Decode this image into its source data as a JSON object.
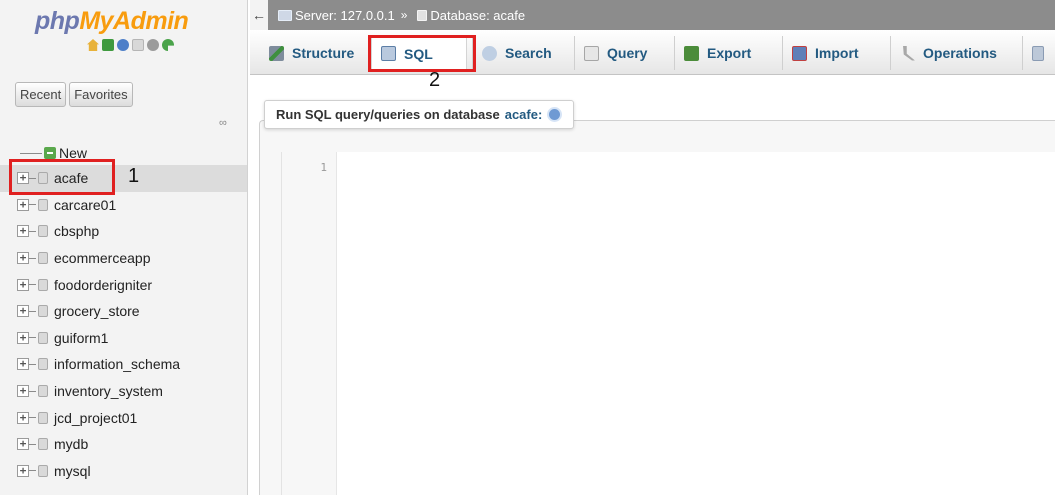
{
  "nav": {
    "logo": {
      "pre": "php",
      "post": "MyAdmin"
    },
    "icons": [
      "home-icon",
      "database-icon",
      "docs-icon",
      "paper-icon",
      "settings-gear-icon",
      "reload-icon"
    ],
    "tabs": [
      "Recent",
      "Favorites"
    ],
    "new_label": "New",
    "databases": [
      "acafe",
      "carcare01",
      "cbsphp",
      "ecommerceapp",
      "foodorderigniter",
      "grocery_store",
      "guiform1",
      "information_schema",
      "inventory_system",
      "jcd_project01",
      "mydb",
      "mysql"
    ],
    "selected_database": "acafe"
  },
  "breadcrumb": {
    "server": "Server: 127.0.0.1",
    "separator": "»",
    "database": "Database: acafe"
  },
  "menu": {
    "items": [
      "Structure",
      "SQL",
      "Search",
      "Query",
      "Export",
      "Import",
      "Operations"
    ],
    "active": "SQL"
  },
  "sql_panel": {
    "legend_prefix": "Run SQL query/queries on database",
    "legend_db": "acafe:",
    "line_number": "1"
  },
  "annotations": {
    "box1_number": "1",
    "box2_number": "2",
    "color": "#e02020"
  },
  "colors": {
    "link": "#235a81",
    "logo_php": "#6c78af",
    "logo_myadmin": "#f89c0e",
    "topbar": "#8c8c8c"
  }
}
